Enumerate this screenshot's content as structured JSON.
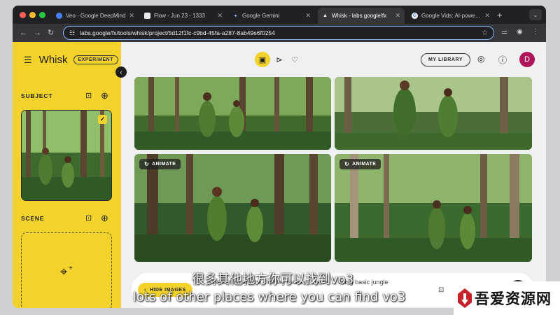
{
  "browser": {
    "tabs": [
      {
        "label": "Veo - Google DeepMind",
        "icon": "globe-icon"
      },
      {
        "label": "Flow - Jun 23 - 1333",
        "icon": "flow-icon"
      },
      {
        "label": "Google Gemini",
        "icon": "gemini-icon"
      },
      {
        "label": "Whisk - labs.google/fx",
        "icon": "whisk-icon",
        "active": true
      },
      {
        "label": "Google Vids: AI-powered",
        "icon": "google-icon"
      }
    ],
    "new_tab": "+",
    "tab_menu": "⌄",
    "url": "labs.google/fx/tools/whisk/project/5d12f1fc-c9bd-45fa-a287-8ab49e6f0254"
  },
  "app": {
    "name": "Whisk",
    "badge": "EXPERIMENT",
    "sections": {
      "subject": "SUBJECT",
      "scene": "SCENE"
    },
    "my_library": "MY LIBRARY",
    "avatar_letter": "D",
    "animate_label": "ANIMATE",
    "hide_images_label": "HIDE IMAGES",
    "prompt_text": "...  organic through the clothing made of leaves  ...  using basic jungle"
  },
  "captions": {
    "zh": "很多其他地方你可以找到vo3",
    "en": "lots of other places where you can find vo3"
  },
  "watermark": {
    "text": "吾爱资源网"
  },
  "colors": {
    "accent_yellow": "#f2d22b",
    "avatar": "#b0175a",
    "chrome_dark": "#202124",
    "omnibox_focus": "#8ab4f8"
  }
}
